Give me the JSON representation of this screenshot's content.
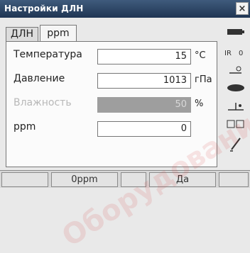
{
  "window": {
    "title": "Настройки ДЛН",
    "close_label": "×"
  },
  "tabs": [
    {
      "label": "ДЛН",
      "active": false
    },
    {
      "label": "ppm",
      "active": true
    }
  ],
  "fields": {
    "temperature": {
      "label": "Температура",
      "value": "15",
      "unit": "°C"
    },
    "pressure": {
      "label": "Давление",
      "value": "1013",
      "unit": "гПа"
    },
    "humidity": {
      "label": "Влажность",
      "value": "50",
      "unit": "%",
      "enabled": false
    },
    "ppm": {
      "label": "ppm",
      "value": "0",
      "unit": ""
    }
  },
  "sidebar": {
    "icons": [
      "battery-icon",
      "edm-mode-icon",
      "reflector-icon",
      "laser-icon",
      "level-icon",
      "keyboard-icon",
      "pen-icon"
    ]
  },
  "softkeys": [
    {
      "label": ""
    },
    {
      "label": "0ppm"
    },
    {
      "label": ""
    },
    {
      "label": "Да"
    },
    {
      "label": ""
    }
  ],
  "watermark": {
    "text": "Оборудование Геостройизыскания"
  },
  "colors": {
    "title_bar": "#2b4566",
    "disabled_field": "#9e9e9e",
    "watermark": "#dc3c3c"
  }
}
